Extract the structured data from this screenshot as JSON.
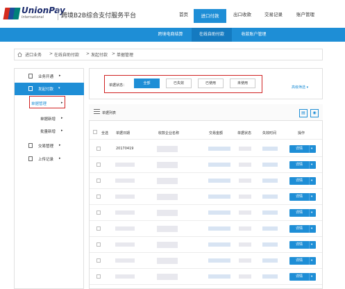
{
  "header": {
    "logo_sub": "International",
    "brand": "UnionPay",
    "platform_title": "跨境B2B综合支付服务平台",
    "nav": [
      {
        "label": "首页"
      },
      {
        "label": "进口付款"
      },
      {
        "label": "出口收款"
      },
      {
        "label": "交易记录"
      },
      {
        "label": "账户管理"
      }
    ]
  },
  "subnav": [
    {
      "label": "跨境电商结算"
    },
    {
      "label": "在线自助付款"
    },
    {
      "label": "收款账户管理"
    }
  ],
  "breadcrumb": [
    "进口业务",
    ">",
    "在线自助付款",
    ">",
    "发起付款",
    ">",
    "单据管理"
  ],
  "sidebar": {
    "items": [
      {
        "label": "业务开通",
        "arrow": "▸"
      },
      {
        "label": "发起付款",
        "arrow": "▾"
      },
      {
        "label": "交易管理",
        "arrow": "▸"
      },
      {
        "label": "上传记录",
        "arrow": "▸"
      }
    ],
    "sub_items": [
      {
        "label": "单据管理",
        "arrow": "▸"
      },
      {
        "label": "单据新增",
        "arrow": "▸"
      },
      {
        "label": "批量新增",
        "arrow": "▸"
      }
    ]
  },
  "filter": {
    "label": "单据状态：",
    "buttons": [
      {
        "label": "全部"
      },
      {
        "label": "已失效"
      },
      {
        "label": "已使用"
      },
      {
        "label": "未使用"
      }
    ],
    "advanced": "高级筛选 ▾"
  },
  "list": {
    "title": "单据列表",
    "columns": [
      "全选",
      "单据日期",
      "收款企业名称",
      "交易金额",
      "单据状态",
      "失效时间",
      "操作"
    ],
    "rows": [
      {
        "date": "20170419"
      },
      {
        "date": ""
      },
      {
        "date": ""
      },
      {
        "date": ""
      },
      {
        "date": ""
      },
      {
        "date": ""
      },
      {
        "date": ""
      },
      {
        "date": ""
      },
      {
        "date": ""
      }
    ],
    "detail_label": "详情",
    "detail_arrow": "▾"
  }
}
